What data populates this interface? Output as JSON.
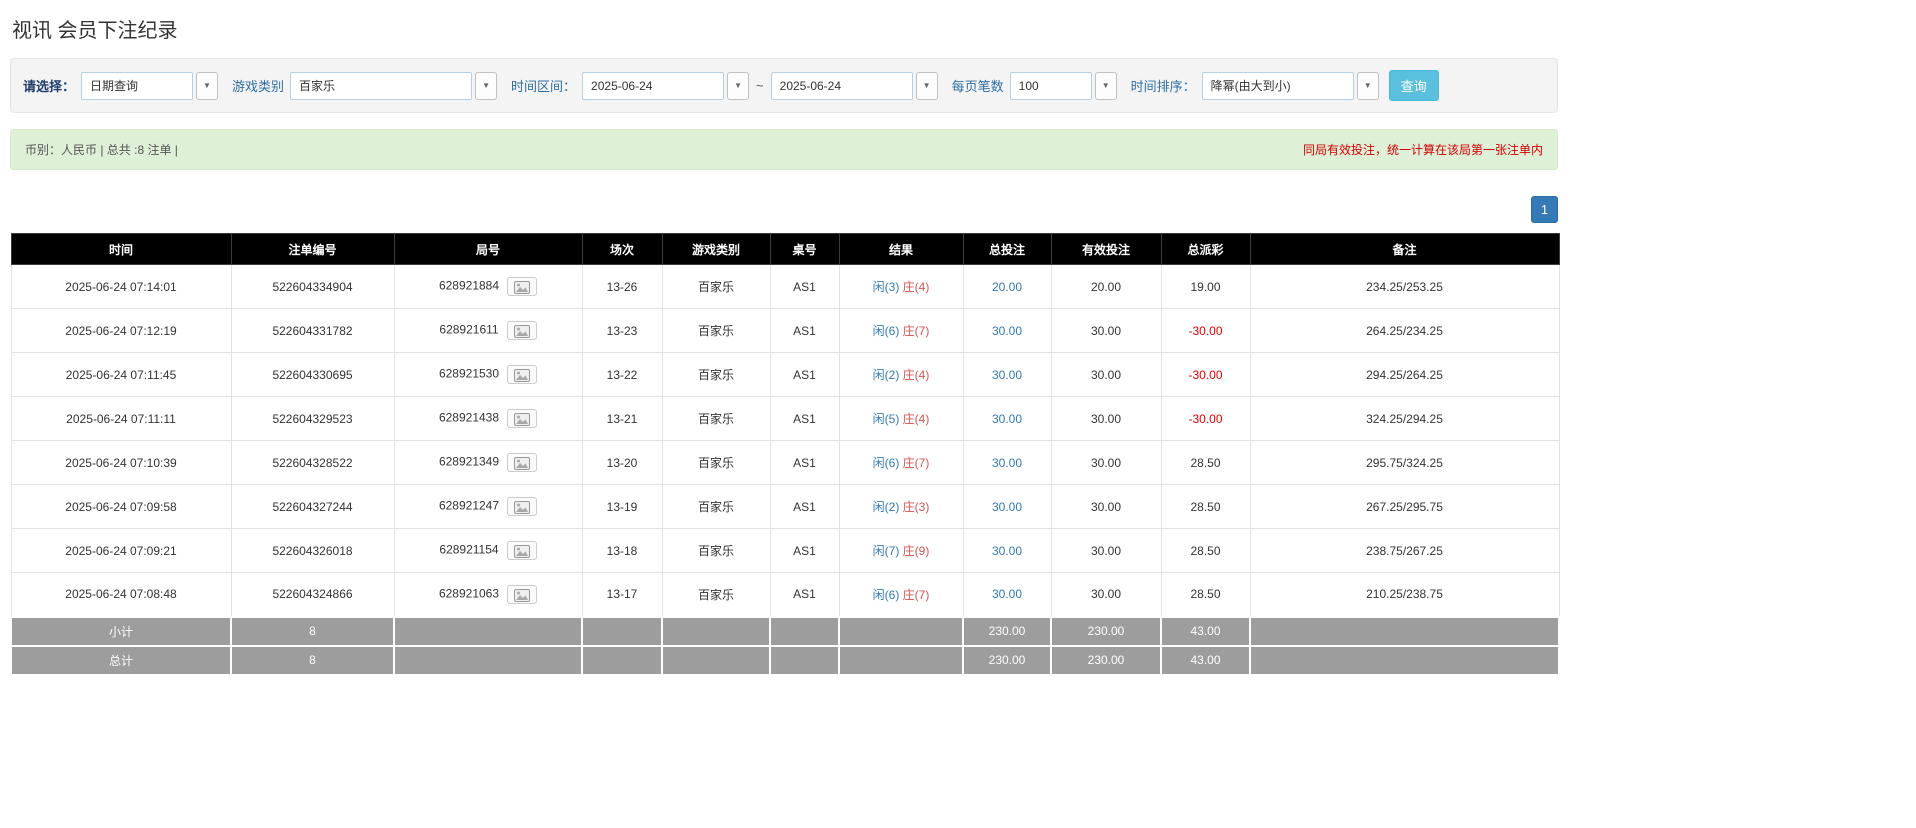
{
  "page": {
    "title": "视讯 会员下注纪录"
  },
  "filters": {
    "query_type": {
      "label": "请选择：",
      "value": "日期查询"
    },
    "game_type": {
      "label": "游戏类别",
      "value": "百家乐"
    },
    "time_range": {
      "label": "时间区间：",
      "from": "2025-06-24",
      "separator": "~",
      "to": "2025-06-24"
    },
    "page_size": {
      "label": "每页笔数",
      "value": "100"
    },
    "sort": {
      "label": "时间排序：",
      "value": "降幂(由大到小)"
    },
    "search_label": "查询"
  },
  "summary": {
    "info": "币别：人民币 | 总共 :8 注单 |",
    "notice": "同局有效投注，统一计算在该局第一张注单内"
  },
  "pagination": {
    "pages": [
      "1"
    ]
  },
  "table": {
    "headers": [
      "时间",
      "注单编号",
      "局号",
      "场次",
      "游戏类别",
      "桌号",
      "结果",
      "总投注",
      "有效投注",
      "总派彩",
      "备注"
    ],
    "rows": [
      {
        "time": "2025-06-24 07:14:01",
        "bet_id": "522604334904",
        "round": "628921884",
        "session": "13-26",
        "game_type": "百家乐",
        "table_no": "AS1",
        "result_player": "闲(3)",
        "result_banker": "庄(4)",
        "total_bet": "20.00",
        "valid_bet": "20.00",
        "payout": "19.00",
        "note": "234.25/253.25"
      },
      {
        "time": "2025-06-24 07:12:19",
        "bet_id": "522604331782",
        "round": "628921611",
        "session": "13-23",
        "game_type": "百家乐",
        "table_no": "AS1",
        "result_player": "闲(6)",
        "result_banker": "庄(7)",
        "total_bet": "30.00",
        "valid_bet": "30.00",
        "payout": "-30.00",
        "note": "264.25/234.25"
      },
      {
        "time": "2025-06-24 07:11:45",
        "bet_id": "522604330695",
        "round": "628921530",
        "session": "13-22",
        "game_type": "百家乐",
        "table_no": "AS1",
        "result_player": "闲(2)",
        "result_banker": "庄(4)",
        "total_bet": "30.00",
        "valid_bet": "30.00",
        "payout": "-30.00",
        "note": "294.25/264.25"
      },
      {
        "time": "2025-06-24 07:11:11",
        "bet_id": "522604329523",
        "round": "628921438",
        "session": "13-21",
        "game_type": "百家乐",
        "table_no": "AS1",
        "result_player": "闲(5)",
        "result_banker": "庄(4)",
        "total_bet": "30.00",
        "valid_bet": "30.00",
        "payout": "-30.00",
        "note": "324.25/294.25"
      },
      {
        "time": "2025-06-24 07:10:39",
        "bet_id": "522604328522",
        "round": "628921349",
        "session": "13-20",
        "game_type": "百家乐",
        "table_no": "AS1",
        "result_player": "闲(6)",
        "result_banker": "庄(7)",
        "total_bet": "30.00",
        "valid_bet": "30.00",
        "payout": "28.50",
        "note": "295.75/324.25"
      },
      {
        "time": "2025-06-24 07:09:58",
        "bet_id": "522604327244",
        "round": "628921247",
        "session": "13-19",
        "game_type": "百家乐",
        "table_no": "AS1",
        "result_player": "闲(2)",
        "result_banker": "庄(3)",
        "total_bet": "30.00",
        "valid_bet": "30.00",
        "payout": "28.50",
        "note": "267.25/295.75"
      },
      {
        "time": "2025-06-24 07:09:21",
        "bet_id": "522604326018",
        "round": "628921154",
        "session": "13-18",
        "game_type": "百家乐",
        "table_no": "AS1",
        "result_player": "闲(7)",
        "result_banker": "庄(9)",
        "total_bet": "30.00",
        "valid_bet": "30.00",
        "payout": "28.50",
        "note": "238.75/267.25"
      },
      {
        "time": "2025-06-24 07:08:48",
        "bet_id": "522604324866",
        "round": "628921063",
        "session": "13-17",
        "game_type": "百家乐",
        "table_no": "AS1",
        "result_player": "闲(6)",
        "result_banker": "庄(7)",
        "total_bet": "30.00",
        "valid_bet": "30.00",
        "payout": "28.50",
        "note": "210.25/238.75"
      }
    ],
    "subtotal": {
      "label": "小计",
      "count": "8",
      "total_bet": "230.00",
      "valid_bet": "230.00",
      "payout": "43.00"
    },
    "total": {
      "label": "总计",
      "count": "8",
      "total_bet": "230.00",
      "valid_bet": "230.00",
      "payout": "43.00"
    }
  },
  "colors": {
    "accent_blue": "#337ab7",
    "banker_red": "#d9534f",
    "negative_red": "#e60000",
    "search_button_bg": "#5bc0de",
    "header_bg": "#000000",
    "footer_bg": "#9d9d9d",
    "summary_bg": "#dff0d8"
  }
}
